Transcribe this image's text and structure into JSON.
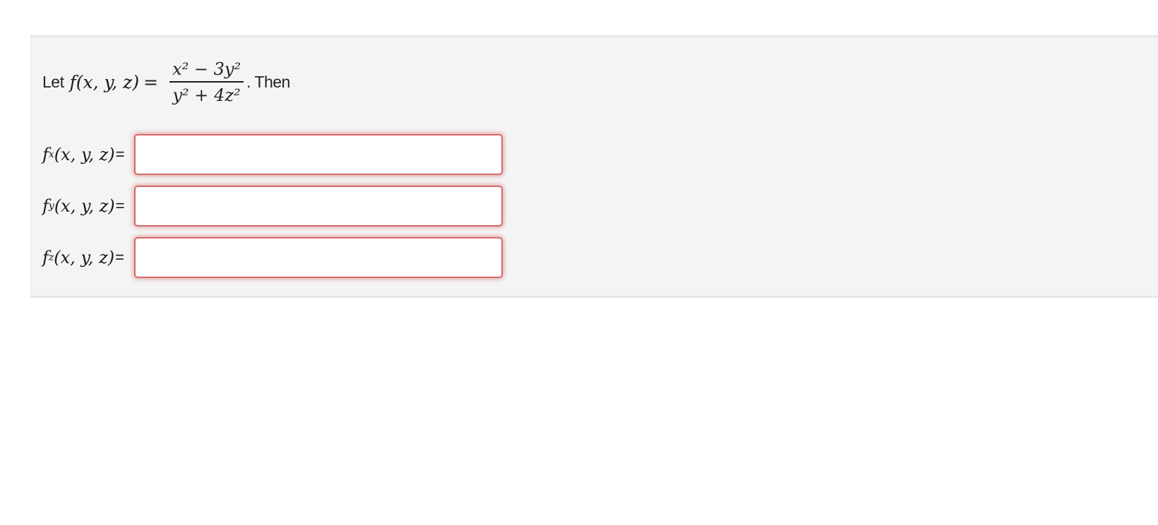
{
  "problem": {
    "intro": "Let",
    "func_lhs": "f(x, y, z)",
    "equals": "=",
    "numerator": "x² − 3y²",
    "denominator": "y² + 4z²",
    "outro": ". Then"
  },
  "fields": [
    {
      "fn": "f",
      "subscript": "x",
      "args": "(x, y, z)",
      "eq": "=",
      "value": "",
      "placeholder": ""
    },
    {
      "fn": "f",
      "subscript": "y",
      "args": "(x, y, z)",
      "eq": "=",
      "value": "",
      "placeholder": ""
    },
    {
      "fn": "f",
      "subscript": "z",
      "args": "(x, y, z)",
      "eq": "=",
      "value": "",
      "placeholder": ""
    }
  ],
  "colors": {
    "panel_background": "#f4f4f4",
    "input_border_error": "#d46a6a",
    "input_glow": "#e5a0a0"
  }
}
